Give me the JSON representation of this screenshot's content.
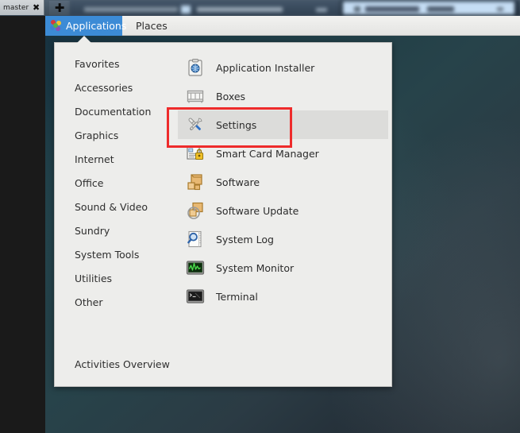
{
  "window": {
    "tab_label": "master",
    "close_icon": "close-icon",
    "new_tab_icon": "plus-icon"
  },
  "panel": {
    "applications_label": "Applications",
    "applications_icon": "fedora-applications-icon",
    "places_label": "Places",
    "active_menu": "Applications",
    "highlight_color": "#3c8bd6"
  },
  "menu": {
    "categories": [
      {
        "label": "Favorites"
      },
      {
        "label": "Accessories"
      },
      {
        "label": "Documentation"
      },
      {
        "label": "Graphics"
      },
      {
        "label": "Internet"
      },
      {
        "label": "Office"
      },
      {
        "label": "Sound & Video"
      },
      {
        "label": "Sundry"
      },
      {
        "label": "System Tools"
      },
      {
        "label": "Utilities"
      },
      {
        "label": "Other"
      }
    ],
    "selected_category": "System Tools",
    "applications": [
      {
        "label": "Application Installer",
        "icon": "application-installer-icon",
        "selected": false
      },
      {
        "label": "Boxes",
        "icon": "boxes-icon",
        "selected": false
      },
      {
        "label": "Settings",
        "icon": "settings-tools-icon",
        "selected": true
      },
      {
        "label": "Smart Card Manager",
        "icon": "smart-card-manager-icon",
        "selected": false
      },
      {
        "label": "Software",
        "icon": "software-package-icon",
        "selected": false
      },
      {
        "label": "Software Update",
        "icon": "software-update-icon",
        "selected": false
      },
      {
        "label": "System Log",
        "icon": "system-log-icon",
        "selected": false
      },
      {
        "label": "System Monitor",
        "icon": "system-monitor-icon",
        "selected": false
      },
      {
        "label": "Terminal",
        "icon": "terminal-icon",
        "selected": false
      }
    ],
    "activities_overview_label": "Activities Overview"
  },
  "annotation": {
    "target": "Settings",
    "color": "#ee2b2b"
  }
}
